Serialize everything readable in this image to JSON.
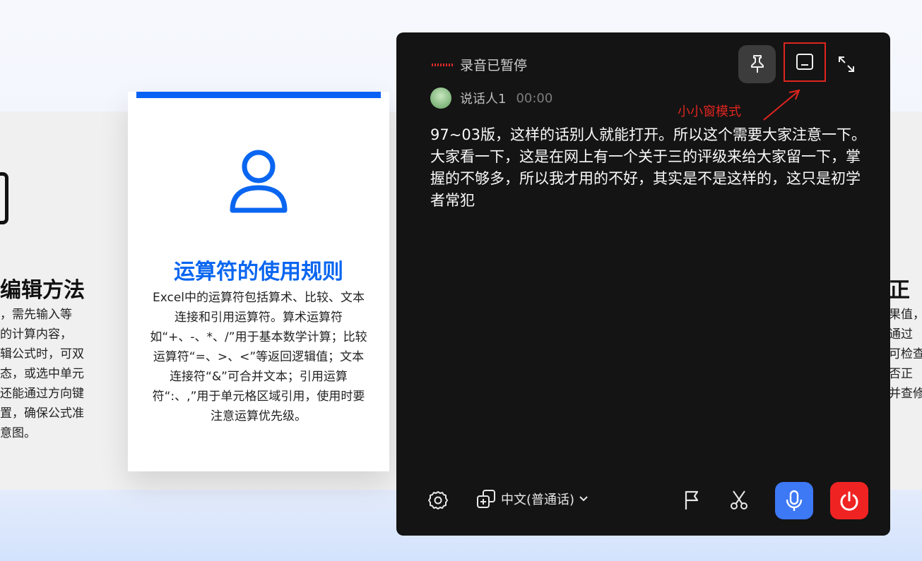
{
  "background": {
    "left_card": {
      "title": "编辑方法",
      "body_lines": [
        "，需先输入等",
        "的计算内容，",
        "辑公式时，可双",
        "态，或选中单元",
        "还能通过方向键",
        "置，确保公式准",
        "意图。"
      ]
    },
    "right_card": {
      "title": "正",
      "body_lines": [
        "果值，",
        "通过",
        "可检查",
        "否正",
        "并查修"
      ]
    },
    "center_card": {
      "icon": "person-icon",
      "title": "运算符的使用规则",
      "body": "Excel中的运算符包括算术、比较、文本连接和引用运算符。算术运算符如“+、-、*、/”用于基本数学计算；比较运算符“=、>、<”等返回逻辑值；文本连接符“&”可合并文本；引用运算符“:、,”用于单元格区域引用，使用时要注意运算优先级。",
      "accent_color": "#0a66f0"
    }
  },
  "panel": {
    "status_text": "录音已暂停",
    "speaker_name": "说话人1",
    "speaker_time": "00:00",
    "annotation_label": "小小窗模式",
    "transcript": "97~03版，这样的话别人就能打开。所以这个需要大家注意一下。大家看一下，这是在网上有一个关于三的评级来给大家留一下，掌握的不够多，所以我才用的不好，其实是不是这样的，这只是初学者常犯",
    "language": "中文(普通话)",
    "icons": {
      "pin": "pin-icon",
      "mini_window": "mini-window-icon",
      "expand": "expand-icon",
      "settings": "gear-icon",
      "translate": "translate-icon",
      "flag": "flag-icon",
      "scissors": "scissors-icon",
      "mic": "microphone-icon",
      "power": "power-icon"
    },
    "colors": {
      "panel_bg": "#141414",
      "mic_button": "#3d78f5",
      "power_button": "#f02323",
      "annotation": "#e0251f"
    }
  }
}
